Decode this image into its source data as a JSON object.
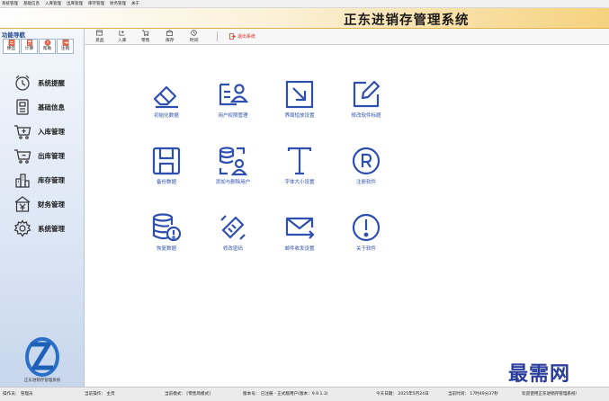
{
  "menubar": [
    "系统管理",
    "基础信息",
    "入库管理",
    "出库管理",
    "库存管理",
    "财务管理",
    "关于"
  ],
  "app_title": "正东进销存管理系统",
  "sidebar": {
    "heading": "功能导航",
    "quick_buttons": [
      {
        "label": "便签",
        "icon": "note-icon"
      },
      {
        "label": "计算",
        "icon": "calculator-icon"
      },
      {
        "label": "帮助",
        "icon": "help-icon"
      },
      {
        "label": "注销",
        "icon": "logout-icon"
      }
    ],
    "items": [
      {
        "label": "系统提醒",
        "icon": "alarm-clock-icon"
      },
      {
        "label": "基础信息",
        "icon": "info-card-icon"
      },
      {
        "label": "入库管理",
        "icon": "cart-in-icon"
      },
      {
        "label": "出库管理",
        "icon": "cart-out-icon"
      },
      {
        "label": "库存管理",
        "icon": "warehouse-icon"
      },
      {
        "label": "财务管理",
        "icon": "yuan-icon"
      },
      {
        "label": "系统管理",
        "icon": "gear-icon"
      }
    ],
    "logo_caption": "正东进销存管理系统"
  },
  "toolbar": {
    "buttons": [
      {
        "label": "货品",
        "icon": "goods-icon"
      },
      {
        "label": "入库",
        "icon": "stock-in-icon"
      },
      {
        "label": "零售",
        "icon": "retail-icon"
      },
      {
        "label": "库存",
        "icon": "inventory-icon"
      },
      {
        "label": "时间",
        "icon": "clock-icon"
      }
    ],
    "exit_label": "退出系统"
  },
  "functions": [
    {
      "label": "初始化数据",
      "icon": "eraser-icon"
    },
    {
      "label": "用户权限管理",
      "icon": "user-permission-icon"
    },
    {
      "label": "界面短放设置",
      "icon": "resize-window-icon"
    },
    {
      "label": "修改软件标题",
      "icon": "edit-icon"
    },
    {
      "label": "备份数据",
      "icon": "save-icon"
    },
    {
      "label": "添加与删除用户",
      "icon": "database-user-icon"
    },
    {
      "label": "字体大小设置",
      "icon": "font-size-icon"
    },
    {
      "label": "注册软件",
      "icon": "registered-icon"
    },
    {
      "label": "恢复数据",
      "icon": "database-restore-icon"
    },
    {
      "label": "修改密码",
      "icon": "password-icon"
    },
    {
      "label": "邮件收发设置",
      "icon": "mail-icon"
    },
    {
      "label": "关于软件",
      "icon": "about-icon"
    }
  ],
  "status": {
    "operator": "操作员： 管理员",
    "current_op": "当前操作： 主页",
    "mode": "当前模式： [零售简模式]",
    "version": "版本号： 已注册 - 正式版用户(版本：9.9.1.3)",
    "date": "今天日期： 2025年5月24日",
    "time": "当前时间： 17时49分37秒",
    "welcome": "欢迎使用正东进销存管理系统!"
  },
  "watermark": "最需网",
  "colors": {
    "accent_blue": "#2d4fb0",
    "banner_gold": "#f5d27e",
    "exit_red": "#d03020"
  }
}
